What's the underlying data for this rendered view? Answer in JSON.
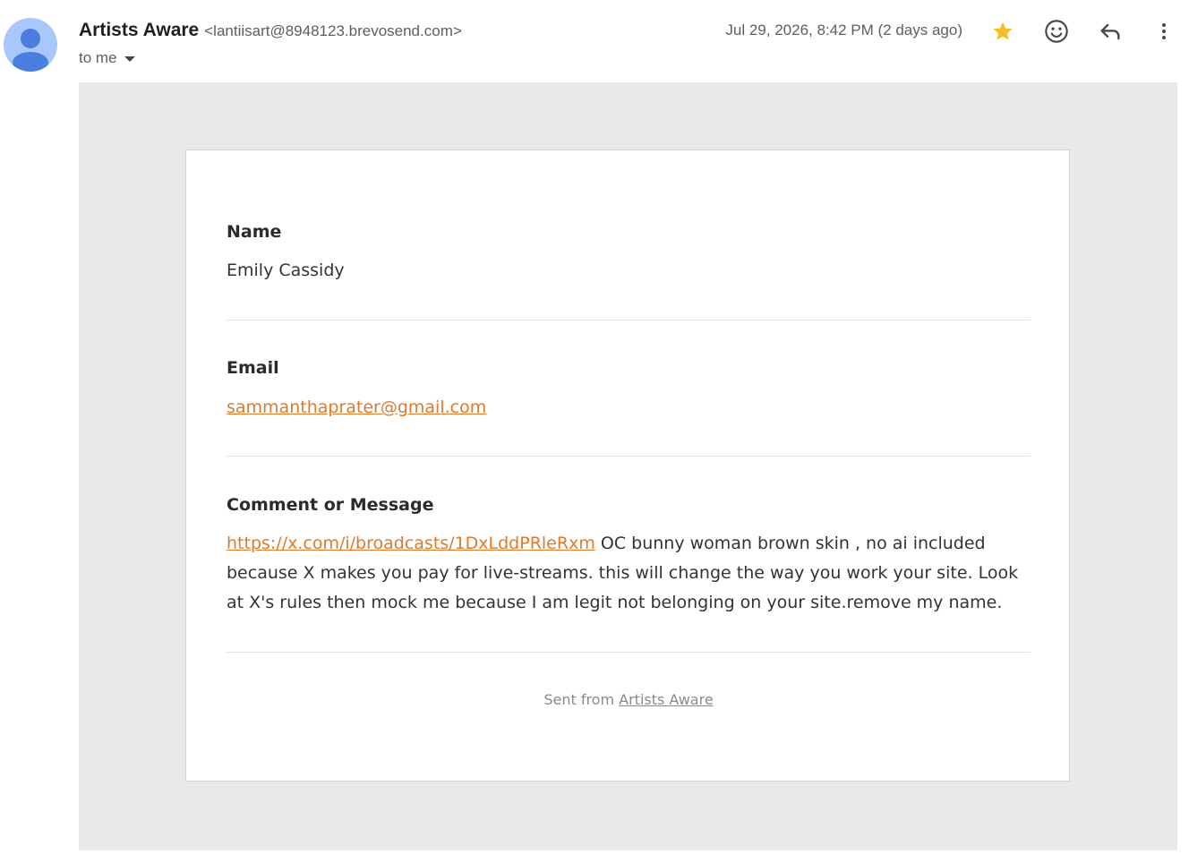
{
  "header": {
    "sender_name": "Artists Aware",
    "sender_email": "<lantiisart@8948123.brevosend.com>",
    "recipient": "to me",
    "timestamp": "Jul 29, 2026, 8:42 PM (2 days ago)",
    "icons": {
      "avatar": "person-icon",
      "star": "star-icon",
      "emoji": "emoji-icon",
      "reply": "reply-icon",
      "more": "more-vert-icon"
    },
    "colors": {
      "star": "#f6bf26",
      "avatar_bg": "#a8c7fa",
      "avatar_fg": "#4a7fe0"
    }
  },
  "form": {
    "name_label": "Name",
    "name_value": "Emily Cassidy",
    "email_label": "Email",
    "email_value": "sammanthaprater@gmail.com",
    "message_label": "Comment or Message",
    "message_link": "https://x.com/i/broadcasts/1DxLddPRleRxm",
    "message_text": " OC bunny woman brown skin , no ai included because X makes you pay for live-streams. this will change the way you work your site. Look at X's rules then mock me because I am legit not belonging on your site.remove my name.",
    "colors": {
      "link": "#e07a2a"
    }
  },
  "footer": {
    "prefix": "Sent from ",
    "link_text": "Artists Aware"
  }
}
